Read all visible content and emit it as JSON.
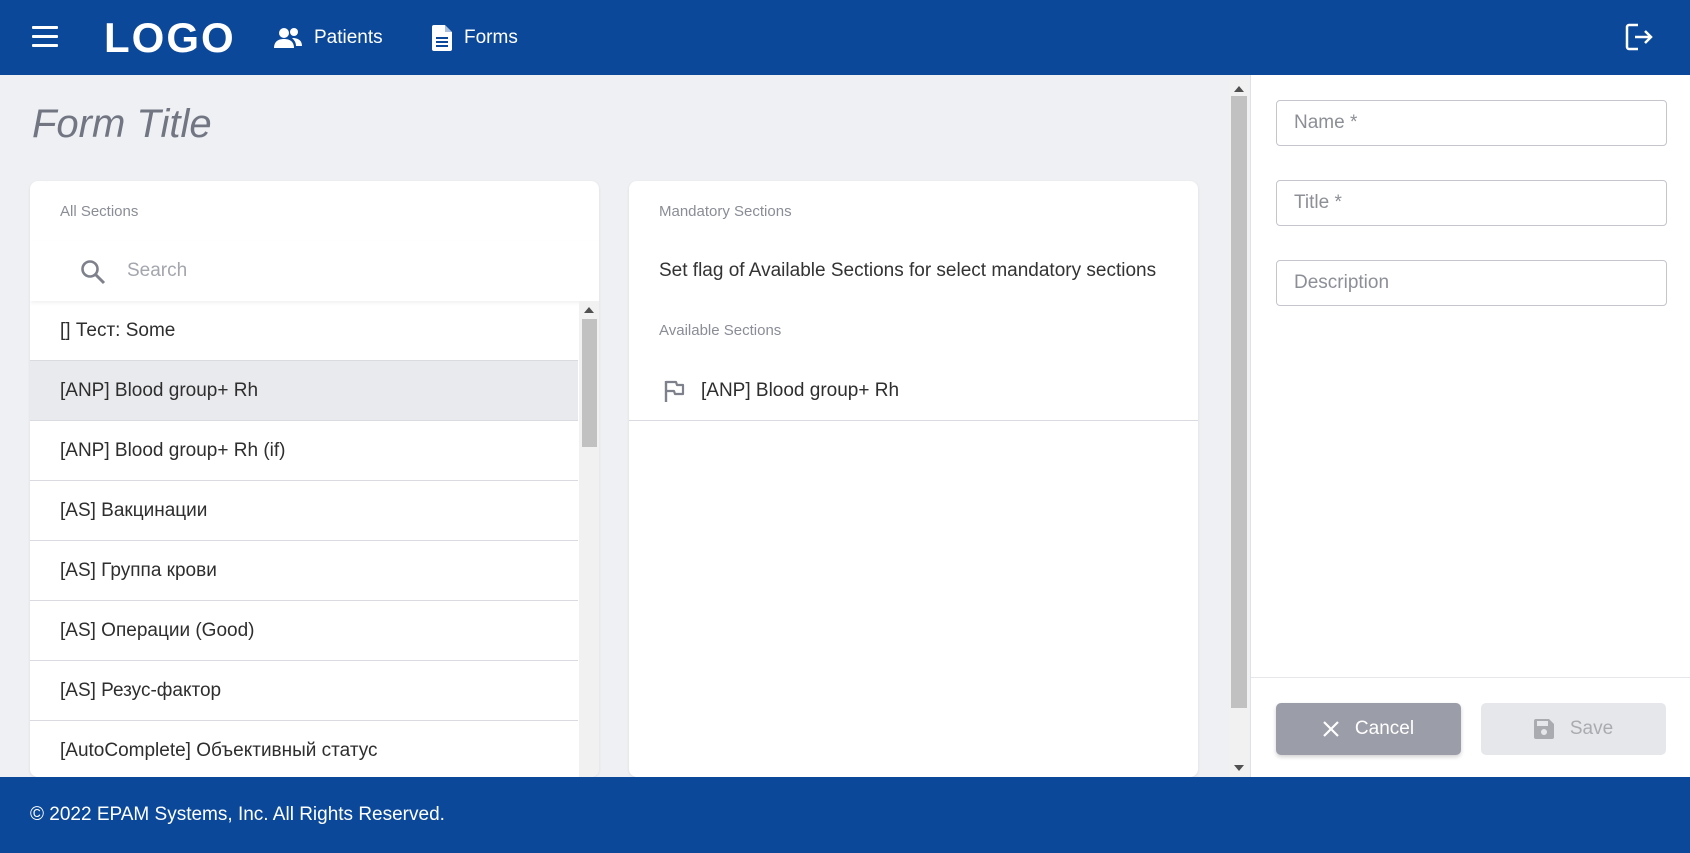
{
  "header": {
    "logo": "LOGO",
    "nav": [
      {
        "label": "Patients",
        "icon": "users-icon"
      },
      {
        "label": "Forms",
        "icon": "document-icon"
      }
    ]
  },
  "form": {
    "title": "Form Title"
  },
  "all_sections": {
    "caption": "All Sections",
    "search_placeholder": "Search",
    "items": [
      "[] Тест: Some",
      "[ANP] Blood group+ Rh",
      "[ANP] Blood group+ Rh (if)",
      "[AS] Вакцинации",
      "[AS] Группа крови",
      "[AS] Операции (Good)",
      "[AS] Резус-фактор",
      "[AutoComplete] Объективный статус"
    ],
    "selected_index": 1
  },
  "mandatory_sections": {
    "caption": "Mandatory Sections",
    "hint": "Set flag of Available Sections for select mandatory sections",
    "available_caption": "Available Sections",
    "available_items": [
      "[ANP] Blood group+ Rh"
    ]
  },
  "right_panel": {
    "name_placeholder": "Name *",
    "title_placeholder": "Title *",
    "description_placeholder": "Description",
    "cancel_label": "Cancel",
    "save_label": "Save"
  },
  "footer": {
    "copyright": "© 2022 EPAM Systems, Inc. All Rights Reserved."
  },
  "colors": {
    "brand": "#0b4899",
    "background": "#eff0f3",
    "cancel": "#9b9da8",
    "save_disabled": "#e6e7ea"
  }
}
